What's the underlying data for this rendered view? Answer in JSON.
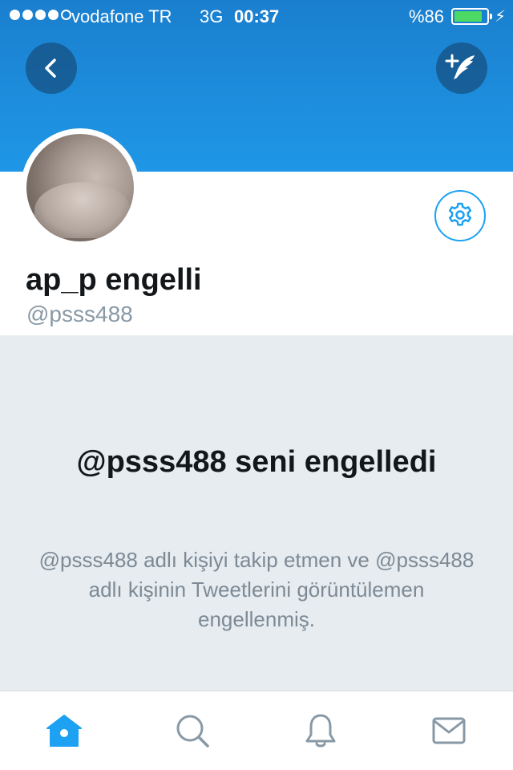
{
  "status_bar": {
    "carrier": "vodafone TR",
    "network": "3G",
    "time": "00:37",
    "battery_percent_text": "%86",
    "battery_level": 0.86,
    "signal_bars_filled": 4,
    "signal_bars_total": 5
  },
  "header": {
    "back_icon": "chevron-left-icon",
    "compose_icon": "compose-tweet-icon",
    "banner_color": "#1f97e6"
  },
  "profile": {
    "display_name": "ap_p engelli",
    "handle": "@psss488",
    "settings_icon": "gear-icon"
  },
  "blocked": {
    "title": "@psss488 seni engelledi",
    "description": "@psss488 adlı kişiyi takip etmen ve @psss488 adlı kişinin Tweetlerini görüntülemen engellenmiş."
  },
  "tab_bar": {
    "active_color": "#1da1f2",
    "inactive_color": "#8899a6",
    "tabs": [
      {
        "icon": "home-icon",
        "active": true
      },
      {
        "icon": "search-icon",
        "active": false
      },
      {
        "icon": "bell-icon",
        "active": false
      },
      {
        "icon": "envelope-icon",
        "active": false
      }
    ]
  }
}
